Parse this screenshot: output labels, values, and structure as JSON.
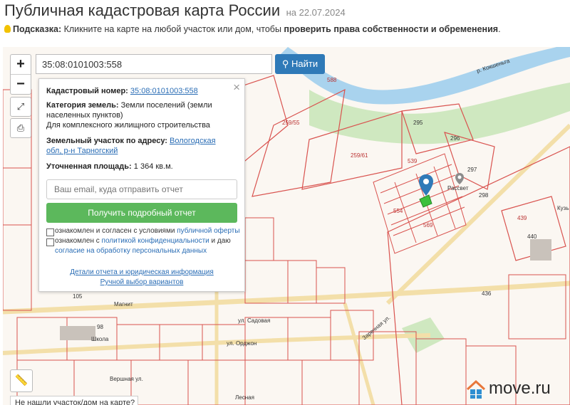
{
  "header": {
    "title": "Публичная кадастровая карта России",
    "date": "на 22.07.2024"
  },
  "hint": {
    "prefix": "Подсказка:",
    "text": " Кликните на карте на любой участок или дом, чтобы ",
    "bold": "проверить права собственности и обременения",
    "suffix": "."
  },
  "search": {
    "value": "35:08:0101003:558",
    "button_label": "Найти"
  },
  "panel": {
    "cad_label": "Кадастровый номер:",
    "cad_value": "35:08:0101003:558",
    "cat_label": "Категория земель:",
    "cat_value": "Земли поселений (земли населенных пунктов)",
    "use_value": "Для комплексного жилищного строительства",
    "addr_label": "Земельный участок по адресу:",
    "addr_value": "Вологодская обл, р-н Тарногский",
    "area_label": "Уточненная площадь:",
    "area_value": "1 364 кв.м.",
    "email_placeholder": "Ваш email, куда отправить отчет",
    "report_button": "Получить подробный отчет",
    "agree1_text": "ознакомлен и согласен с условиями ",
    "agree1_link": "публичной оферты",
    "agree2_text": "ознакомлен с ",
    "agree2_link": "политикой конфиденциальности",
    "agree2_mid": " и даю ",
    "agree2_link2": "согласие на обработку персональных данных",
    "details_link": "Детали отчета и юридическая информация",
    "manual_link": "Ручной выбор вариантов"
  },
  "map": {
    "not_found": "Не нашли участок/дом на карте?",
    "brand": "move.ru",
    "labels": [
      "588",
      "259/55",
      "259/61",
      "295",
      "296",
      "297",
      "539",
      "554",
      "569",
      "298",
      "436",
      "440",
      "439",
      "105",
      "98",
      "Школа",
      "Магнит",
      "Рассвет",
      "р. Кокшеньга",
      "ул. Садовая",
      "Заречная ул.",
      "ул. Орджон",
      "Вершная ул.",
      "Лесная",
      "Кузь"
    ]
  },
  "colors": {
    "accent": "#2f7ab8",
    "green": "#5cb85c",
    "parcel": "#d9534f",
    "river": "#a9d3ee"
  }
}
